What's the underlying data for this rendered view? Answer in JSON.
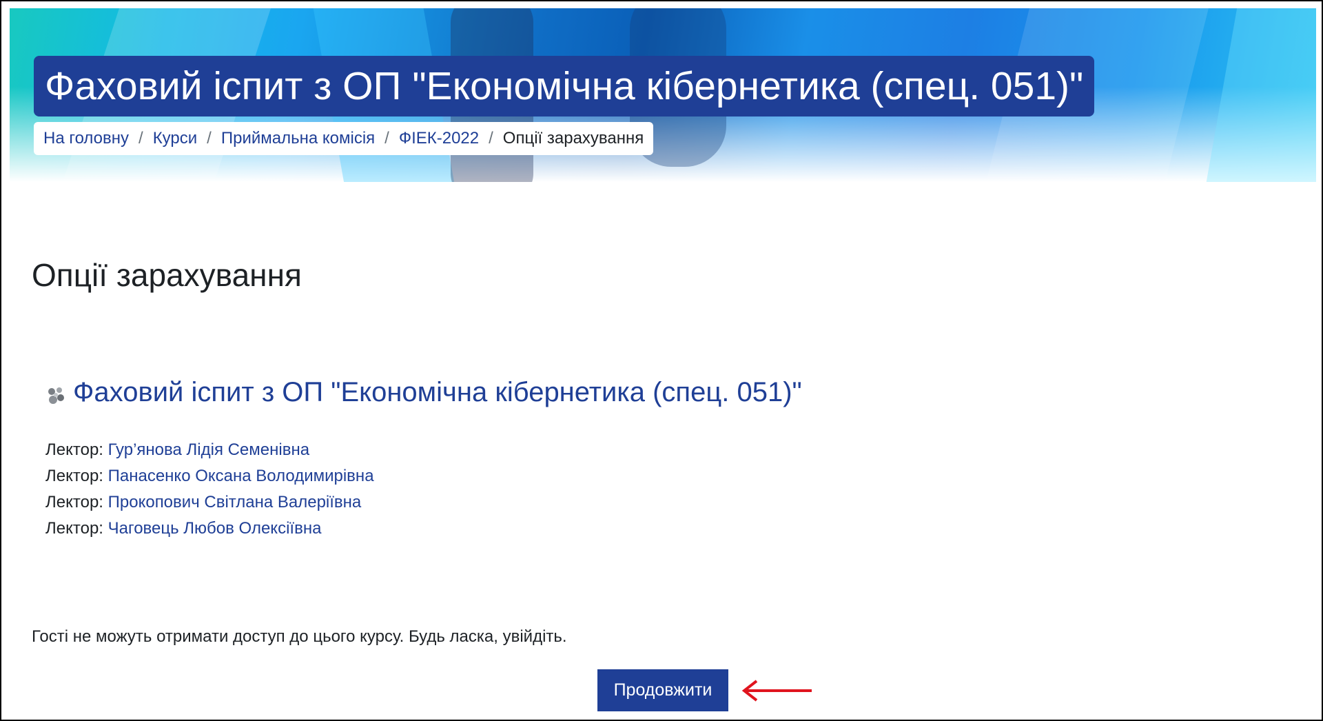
{
  "course": {
    "title": "Фаховий іспит з ОП \"Економічна кібернетика (спец. 051)\""
  },
  "breadcrumb": {
    "items": [
      {
        "label": "На головну"
      },
      {
        "label": "Курси"
      },
      {
        "label": "Приймальна комісія"
      },
      {
        "label": "ФІЕК-2022"
      }
    ],
    "current": "Опції зарахування",
    "separator": "/"
  },
  "main": {
    "heading": "Опції зарахування",
    "course_link": "Фаховий іспит з ОП \"Економічна кібернетика (спец. 051)\"",
    "course_icon": "course-icon",
    "teachers": [
      {
        "role": "Лектор:",
        "name": "Гур’янова Лідія Семенівна"
      },
      {
        "role": "Лектор:",
        "name": "Панасенко Оксана Володимирівна"
      },
      {
        "role": "Лектор:",
        "name": "Прокопович Світлана Валеріївна"
      },
      {
        "role": "Лектор:",
        "name": "Чаговець Любов Олексіївна"
      }
    ],
    "guest_message": "Гості не можуть отримати доступ до цього курсу. Будь ласка, увійдіть.",
    "continue_label": "Продовжити"
  },
  "colors": {
    "primary": "#1f3f96",
    "text": "#1d2125",
    "annotation_arrow": "#e0141e"
  }
}
